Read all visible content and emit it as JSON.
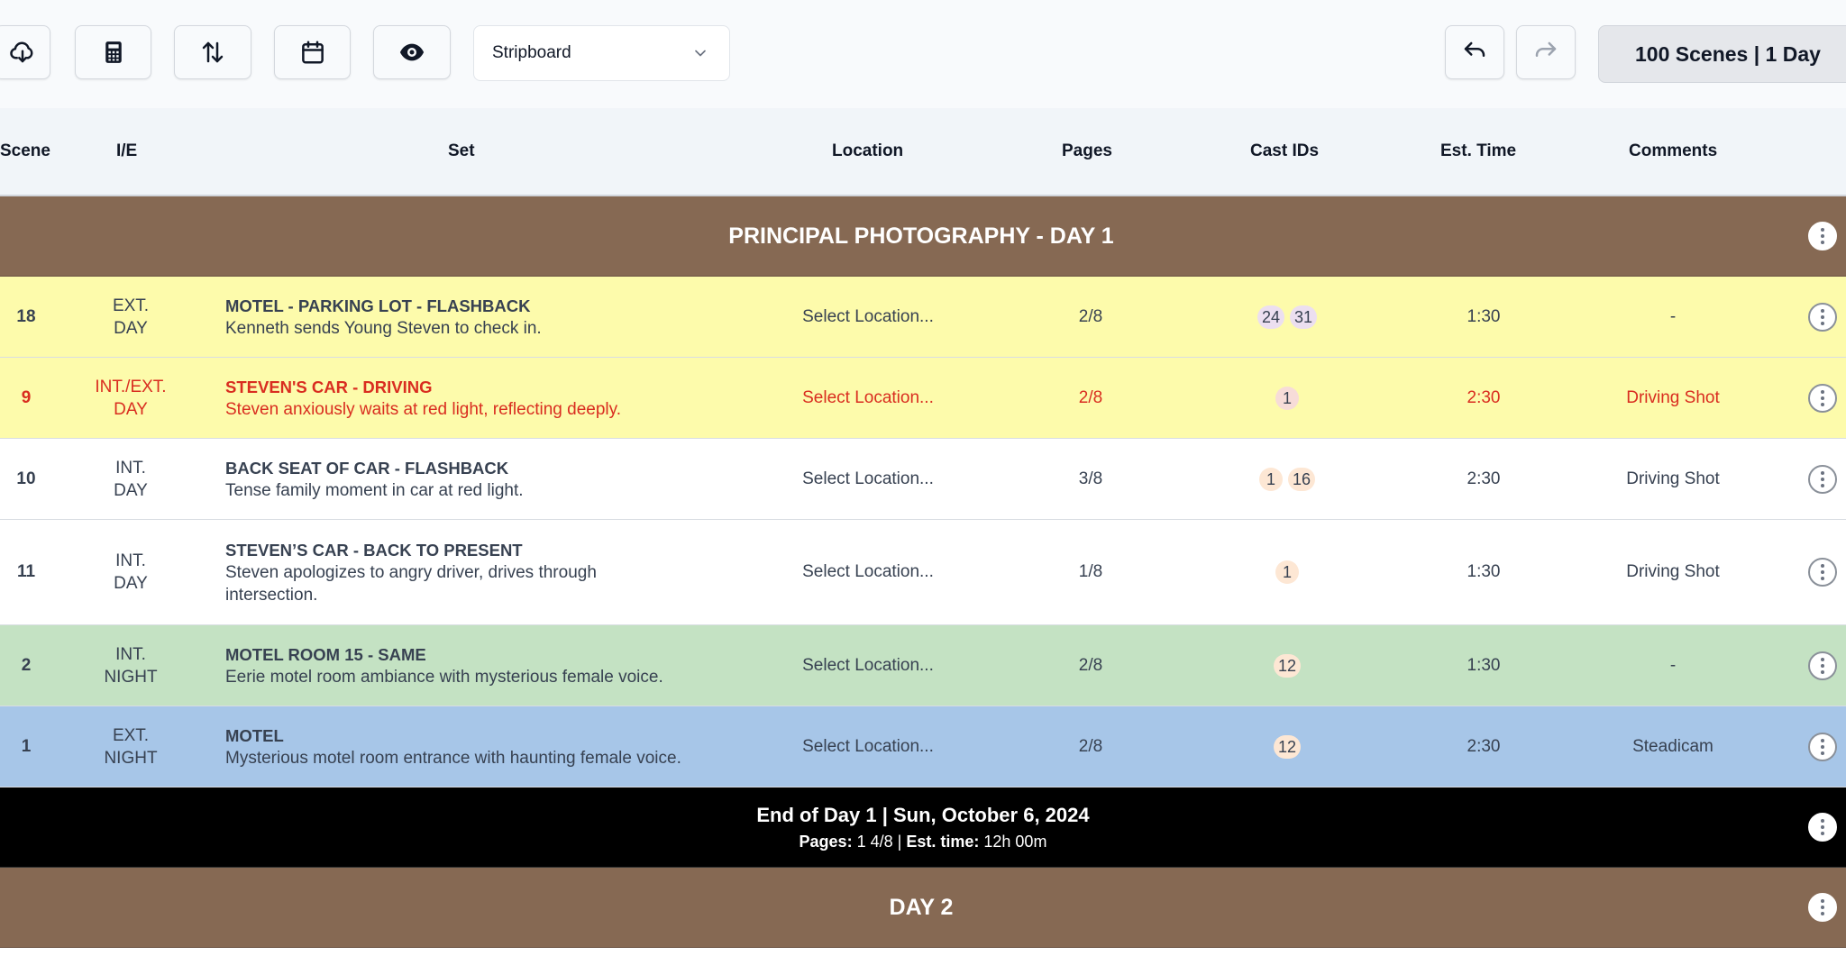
{
  "toolbar": {
    "buttons": [
      {
        "name": "cloud-download-icon"
      },
      {
        "name": "calculator-icon"
      },
      {
        "name": "sort-arrows-icon"
      },
      {
        "name": "calendar-icon"
      },
      {
        "name": "eye-icon"
      }
    ],
    "view_select": {
      "value": "Stripboard"
    },
    "undo": "undo-icon",
    "redo": "redo-icon",
    "summary": "100 Scenes | 1 Day"
  },
  "columns": {
    "scene": "Scene",
    "ie": "I/E",
    "set": "Set",
    "location": "Location",
    "pages": "Pages",
    "cast": "Cast IDs",
    "time": "Est. Time",
    "comments": "Comments"
  },
  "bands": {
    "day1": "PRINCIPAL PHOTOGRAPHY - DAY 1",
    "day2": "DAY 2"
  },
  "rows": [
    {
      "scene": "18",
      "ie1": "EXT.",
      "ie2": "DAY",
      "title": "MOTEL - PARKING LOT - FLASHBACK",
      "desc": "Kenneth sends Young Steven to check in.",
      "location": "Select Location...",
      "pages": "2/8",
      "cast": [
        "24",
        "31"
      ],
      "time": "1:30",
      "comments": "-",
      "color": "#fdfbab"
    },
    {
      "scene": "9",
      "ie1": "INT./EXT.",
      "ie2": "DAY",
      "title": "STEVEN'S CAR - DRIVING",
      "desc": "Steven anxiously waits at red light, reflecting deeply.",
      "location": "Select Location...",
      "pages": "2/8",
      "cast": [
        "1"
      ],
      "time": "2:30",
      "comments": "Driving Shot",
      "color": "#fdfbab"
    },
    {
      "scene": "10",
      "ie1": "INT.",
      "ie2": "DAY",
      "title": "BACK SEAT OF CAR - FLASHBACK",
      "desc": "Tense family moment in car at red light.",
      "location": "Select Location...",
      "pages": "3/8",
      "cast": [
        "1",
        "16"
      ],
      "time": "2:30",
      "comments": "Driving Shot",
      "color": "#ffffff"
    },
    {
      "scene": "11",
      "ie1": "INT.",
      "ie2": "DAY",
      "title": "STEVEN’S CAR - BACK TO PRESENT",
      "desc": "Steven apologizes to angry driver, drives through intersection.",
      "location": "Select Location...",
      "pages": "1/8",
      "cast": [
        "1"
      ],
      "time": "1:30",
      "comments": "Driving Shot",
      "color": "#ffffff"
    },
    {
      "scene": "2",
      "ie1": "INT.",
      "ie2": "NIGHT",
      "title": "MOTEL ROOM 15 - SAME",
      "desc": "Eerie motel room ambiance with mysterious female voice.",
      "location": "Select Location...",
      "pages": "2/8",
      "cast": [
        "12"
      ],
      "time": "1:30",
      "comments": "-",
      "color": "#c4e2c3"
    },
    {
      "scene": "1",
      "ie1": "EXT.",
      "ie2": "NIGHT",
      "title": "MOTEL",
      "desc": "Mysterious motel room entrance with haunting female voice.",
      "location": "Select Location...",
      "pages": "2/8",
      "cast": [
        "12"
      ],
      "time": "2:30",
      "comments": "Steadicam",
      "color": "#a7c6e8"
    }
  ],
  "end_of_day": {
    "title": "End of Day 1 | Sun, October 6, 2024",
    "pages_label": "Pages:",
    "pages_value": "1 4/8",
    "time_label": "Est. time:",
    "time_value": "12h 00m"
  }
}
